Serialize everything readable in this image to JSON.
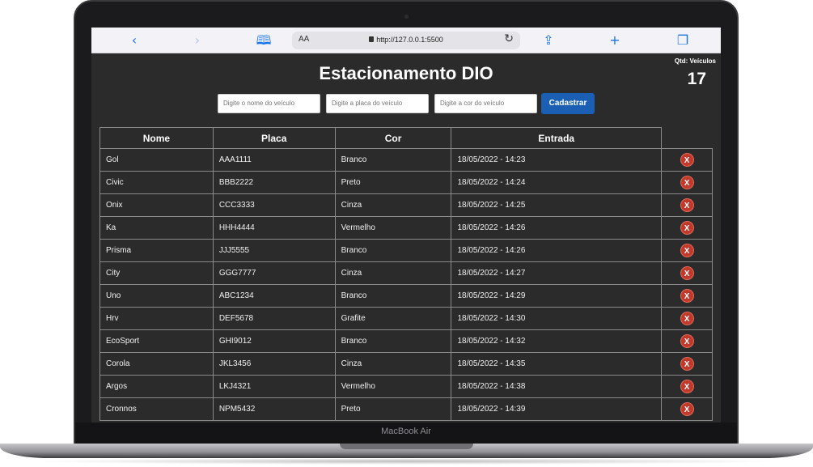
{
  "browser": {
    "back_icon": "chevron-left-icon",
    "forward_icon": "chevron-right-icon",
    "book_icon": "book-icon",
    "reader_label": "AA",
    "url": "http://127.0.0.1:5500",
    "reload_icon": "reload-icon",
    "share_icon": "share-icon",
    "new_tab_icon": "plus-icon",
    "tabs_icon": "tabs-icon"
  },
  "page": {
    "title": "Estacionamento DIO",
    "counter_label": "Qtd: Veículos",
    "counter_value": "17"
  },
  "form": {
    "name_placeholder": "Digite o nome do veículo",
    "plate_placeholder": "Digite a placa do veículo",
    "color_placeholder": "Digite a cor do veículo",
    "submit_label": "Cadastrar",
    "submit_color": "#1a5fb4"
  },
  "table": {
    "headers": [
      "Nome",
      "Placa",
      "Cor",
      "Entrada"
    ],
    "delete_label": "X",
    "rows": [
      {
        "nome": "Gol",
        "placa": "AAA1111",
        "cor": "Branco",
        "entrada": "18/05/2022 - 14:23"
      },
      {
        "nome": "Civic",
        "placa": "BBB2222",
        "cor": "Preto",
        "entrada": "18/05/2022 - 14:24"
      },
      {
        "nome": "Onix",
        "placa": "CCC3333",
        "cor": "Cinza",
        "entrada": "18/05/2022 - 14:25"
      },
      {
        "nome": "Ka",
        "placa": "HHH4444",
        "cor": "Vermelho",
        "entrada": "18/05/2022 - 14:26"
      },
      {
        "nome": "Prisma",
        "placa": "JJJ5555",
        "cor": "Branco",
        "entrada": "18/05/2022 - 14:26"
      },
      {
        "nome": "City",
        "placa": "GGG7777",
        "cor": "Cinza",
        "entrada": "18/05/2022 - 14:27"
      },
      {
        "nome": "Uno",
        "placa": "ABC1234",
        "cor": "Branco",
        "entrada": "18/05/2022 - 14:29"
      },
      {
        "nome": "Hrv",
        "placa": "DEF5678",
        "cor": "Grafite",
        "entrada": "18/05/2022 - 14:30"
      },
      {
        "nome": "EcoSport",
        "placa": "GHI9012",
        "cor": "Branco",
        "entrada": "18/05/2022 - 14:32"
      },
      {
        "nome": "Corola",
        "placa": "JKL3456",
        "cor": "Cinza",
        "entrada": "18/05/2022 - 14:35"
      },
      {
        "nome": "Argos",
        "placa": "LKJ4321",
        "cor": "Vermelho",
        "entrada": "18/05/2022 - 14:38"
      },
      {
        "nome": "Cronnos",
        "placa": "NPM5432",
        "cor": "Preto",
        "entrada": "18/05/2022 - 14:39"
      }
    ]
  },
  "device": {
    "label": "MacBook Air"
  },
  "colors": {
    "background": "#2b2b2b",
    "delete": "#c0392b",
    "link": "#1a73e8"
  }
}
